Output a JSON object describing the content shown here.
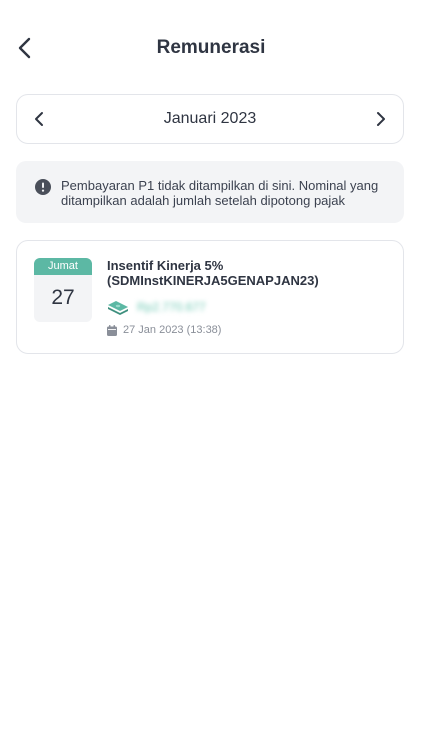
{
  "header": {
    "title": "Remunerasi"
  },
  "month_nav": {
    "label": "Januari 2023"
  },
  "info": {
    "text": "Pembayaran P1 tidak ditampilkan di sini. Nominal yang ditampilkan adalah jumlah setelah dipotong pajak"
  },
  "items": [
    {
      "day_name": "Jumat",
      "day_number": "27",
      "title": "Insentif Kinerja 5% (SDMInstKINERJA5GENAPJAN23)",
      "amount": "Rp2.770.677",
      "timestamp": "27 Jan 2023 (13:38)"
    }
  ],
  "colors": {
    "accent": "#5cb8a4",
    "card_border": "#e3e5ea",
    "info_bg": "#f3f4f6"
  },
  "icons": {
    "back": "chevron-left-icon",
    "prev": "chevron-left-icon",
    "next": "chevron-right-icon",
    "info": "exclamation-circle-icon",
    "money": "money-stack-icon",
    "calendar": "calendar-icon"
  }
}
